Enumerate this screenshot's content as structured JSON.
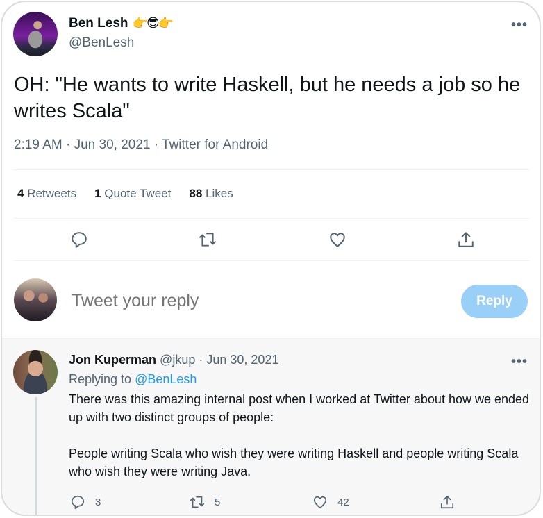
{
  "tweet": {
    "author": {
      "name": "Ben Lesh",
      "emoji": "👉😎👉",
      "handle": "@BenLesh"
    },
    "more_icon": "more-horizontal-icon",
    "text": "OH: \"He wants to write Haskell, but he needs a job so he writes Scala\"",
    "meta": "2:19 AM · Jun 30, 2021 · Twitter for Android",
    "stats": {
      "retweets_count": "4",
      "retweets_label": "Retweets",
      "quotes_count": "1",
      "quotes_label": "Quote Tweet",
      "likes_count": "88",
      "likes_label": "Likes"
    },
    "actions": [
      {
        "name": "reply",
        "icon": "comment-icon"
      },
      {
        "name": "retweet",
        "icon": "retweet-icon"
      },
      {
        "name": "like",
        "icon": "heart-icon"
      },
      {
        "name": "share",
        "icon": "share-icon"
      }
    ]
  },
  "composer": {
    "placeholder": "Tweet your reply",
    "button_label": "Reply",
    "button_color": "#9ad0f7"
  },
  "reply": {
    "author_name": "Jon Kuperman",
    "handle": "@jkup",
    "separator": "·",
    "date": "Jun 30, 2021",
    "replying_prefix": "Replying to",
    "replying_to": "@BenLesh",
    "paragraphs": [
      "There was this amazing internal post when I worked at Twitter about how we ended up with two distinct groups of people:",
      "People writing Scala who wish they were writing Haskell and people writing Scala who wish they were writing Java."
    ],
    "counts": {
      "replies": "3",
      "retweets": "5",
      "likes": "42"
    }
  },
  "colors": {
    "accent": "#1d9bf0",
    "secondary_text": "#536471",
    "primary_text": "#0f1419"
  }
}
